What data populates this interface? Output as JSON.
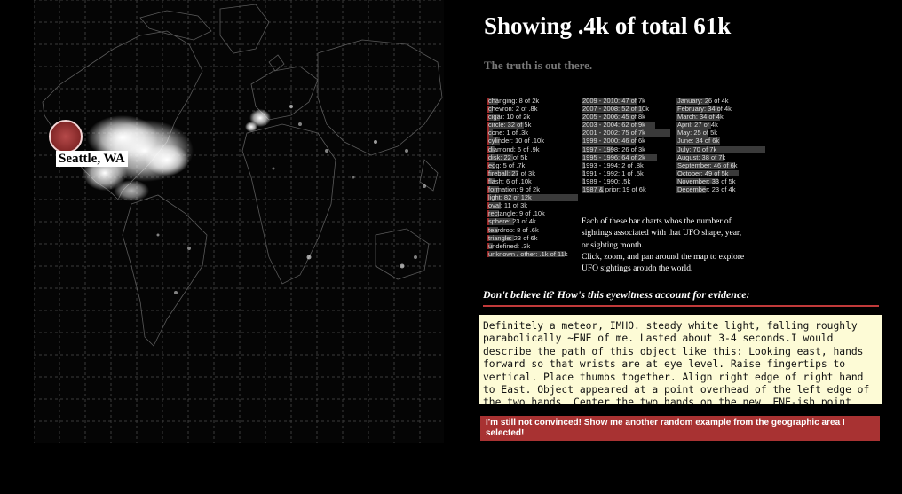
{
  "header": {
    "title": "Showing .4k of total 61k",
    "subtitle": "The truth is out there."
  },
  "map": {
    "location_label": "Seattle, WA"
  },
  "shapes": [
    {
      "label": "changing: 8 of 2k",
      "value": 8
    },
    {
      "label": "chevron: 2 of .8k",
      "value": 2
    },
    {
      "label": "cigar: 10 of 2k",
      "value": 10
    },
    {
      "label": "circle: 32 of 5k",
      "value": 32
    },
    {
      "label": "cone: 1 of .3k",
      "value": 1
    },
    {
      "label": "cylinder: 10 of .10k",
      "value": 10
    },
    {
      "label": "diamond: 6 of .9k",
      "value": 6
    },
    {
      "label": "disk: 22 of 5k",
      "value": 22
    },
    {
      "label": "egg: 5 of .7k",
      "value": 5
    },
    {
      "label": "fireball: 27 of 3k",
      "value": 27
    },
    {
      "label": "flash: 6 of .10k",
      "value": 6
    },
    {
      "label": "formation: 9 of 2k",
      "value": 9
    },
    {
      "label": "light: 82 of 12k",
      "value": 82
    },
    {
      "label": "oval: 11 of 3k",
      "value": 11
    },
    {
      "label": "rectangle: 9 of .10k",
      "value": 9
    },
    {
      "label": "sphere: 23 of 4k",
      "value": 23
    },
    {
      "label": "teardrop: 8 of .6k",
      "value": 8
    },
    {
      "label": "triangle: 23 of 6k",
      "value": 23
    },
    {
      "label": "undefined: .3k",
      "value": 3
    },
    {
      "label": "unknown / other: .1k of 11k",
      "value": 70
    }
  ],
  "years": [
    {
      "label": "2009 - 2010: 47 of 7k",
      "value": 47
    },
    {
      "label": "2007 - 2008: 52 of 10k",
      "value": 52
    },
    {
      "label": "2005 - 2006: 45 of 8k",
      "value": 45
    },
    {
      "label": "2003 - 2004: 62 of 9k",
      "value": 62
    },
    {
      "label": "2001 - 2002: 75 of 7k",
      "value": 75
    },
    {
      "label": "1999 - 2000: 46 of 6k",
      "value": 46
    },
    {
      "label": "1997 - 1998: 26 of 3k",
      "value": 26
    },
    {
      "label": "1995 - 1996: 64 of 2k",
      "value": 64
    },
    {
      "label": "1993 - 1994: 2 of .8k",
      "value": 2
    },
    {
      "label": "1991 - 1992: 1 of .5k",
      "value": 1
    },
    {
      "label": "1989 - 1990: .5k",
      "value": 1
    },
    {
      "label": "1987 & prior: 19 of 6k",
      "value": 19
    }
  ],
  "months": [
    {
      "label": "January: 26 of 4k",
      "value": 26
    },
    {
      "label": "February: 34 of 4k",
      "value": 34
    },
    {
      "label": "March: 34 of 4k",
      "value": 34
    },
    {
      "label": "April: 27 of 4k",
      "value": 27
    },
    {
      "label": "May: 25 of 5k",
      "value": 25
    },
    {
      "label": "June: 34 of 6k",
      "value": 34
    },
    {
      "label": "July: 70 of 7k",
      "value": 70
    },
    {
      "label": "August: 38 of 7k",
      "value": 38
    },
    {
      "label": "September: 46 of 6k",
      "value": 46
    },
    {
      "label": "October: 49 of 5k",
      "value": 49
    },
    {
      "label": "November: 33 of 5k",
      "value": 33
    },
    {
      "label": "December: 23 of 4k",
      "value": 23
    }
  ],
  "description": {
    "line1": "Each of these bar charts whos the number of",
    "line2": "sightings associated with that UFO shape, year,",
    "line3": "or sighting month.",
    "line4": "Click, zoom, and pan around the map to explore",
    "line5": "UFO sightings aroudn the world."
  },
  "account": {
    "heading": "Don't believe it? How's this eyewitness account for evidence:",
    "text": "Definitely a meteor, IMHO. steady white light, falling roughly parabolically ~ENE of me. Lasted about 3-4 seconds.I would describe the path of this object like this: Looking east, hands forward so that wrists are at eye level. Raise fingertips to vertical. Place thumbs together. Align right edge of right hand to East. Object appeared at a point overhead of the left edge of the two hands. Center the two hands on the new, ENE-ish point,"
  },
  "button": {
    "label": "I'm still not convinced! Show me another random example from the geographic area I selected!"
  },
  "colors": {
    "accent": "#a83232",
    "bar": "#3a3a3a",
    "account_bg": "#fdfbd6"
  }
}
